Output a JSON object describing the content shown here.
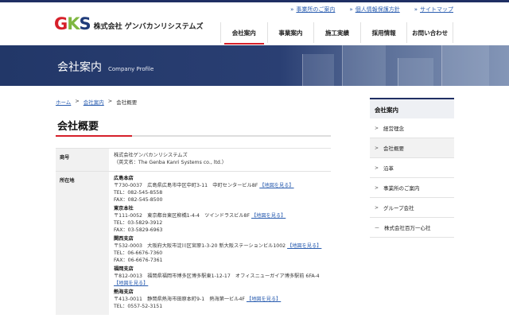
{
  "util_links": [
    "事業所のご案内",
    "個人情報保護方針",
    "サイトマップ"
  ],
  "logo": {
    "mark_g": "G",
    "mark_k": "K",
    "mark_s": "S",
    "company": "株式会社 ゲンバカンリシステムズ"
  },
  "gnav": [
    "会社案内",
    "事業案内",
    "施工実績",
    "採用情報",
    "お問い合わせ"
  ],
  "hero": {
    "title": "会社案内",
    "subtitle": "Company Profile"
  },
  "breadcrumb": {
    "home": "ホーム",
    "section": "会社案内",
    "current": "会社概要"
  },
  "page_title": "会社概要",
  "table": {
    "name_label": "商号",
    "name_line1": "株式会社ゲンバカンリシステムズ",
    "name_line2": "（英文名：The Genba Kanri Systems co., ltd.）",
    "address_label": "所在地",
    "map_link": "【地図を見る】",
    "offices": [
      {
        "name": "広島本店",
        "addr": "〒730-0037　広島県広島市中区中町3-11　中町センタービル8F",
        "tel": "TEL：082-545-8558",
        "fax": "FAX：082-545-8500"
      },
      {
        "name": "東京本社",
        "addr": "〒111-0052　東京都台東区柳橋1-4-4　ツインドラスビル8F",
        "tel": "TEL：03-5829-3912",
        "fax": "FAX：03-5829-6963"
      },
      {
        "name": "関西支店",
        "addr": "〒532-0003　大阪府大阪市淀川区宮原1-3-20 新大阪ステーションビル1002",
        "tel": "TEL：06-6676-7360",
        "fax": "FAX：06-6676-7361"
      },
      {
        "name": "福岡支店",
        "addr": "〒812-0013　福岡県福岡市博多区博多駅東1-12-17　オフィスニューガイア博多駅前 6FA-4"
      },
      {
        "name": "熱海支店",
        "addr": "〒413-0011　静岡県熱海市田原本町9-1　熱海第一ビル4F",
        "tel": "TEL：0557-52-3151"
      }
    ]
  },
  "sidebar": {
    "title": "会社案内",
    "items": [
      "経営理念",
      "会社概要",
      "沿革",
      "事業所のご案内",
      "グループ会社",
      "株式会社百万一心社"
    ],
    "markers": [
      ">",
      ">",
      ">",
      ">",
      ">",
      "ー"
    ]
  }
}
